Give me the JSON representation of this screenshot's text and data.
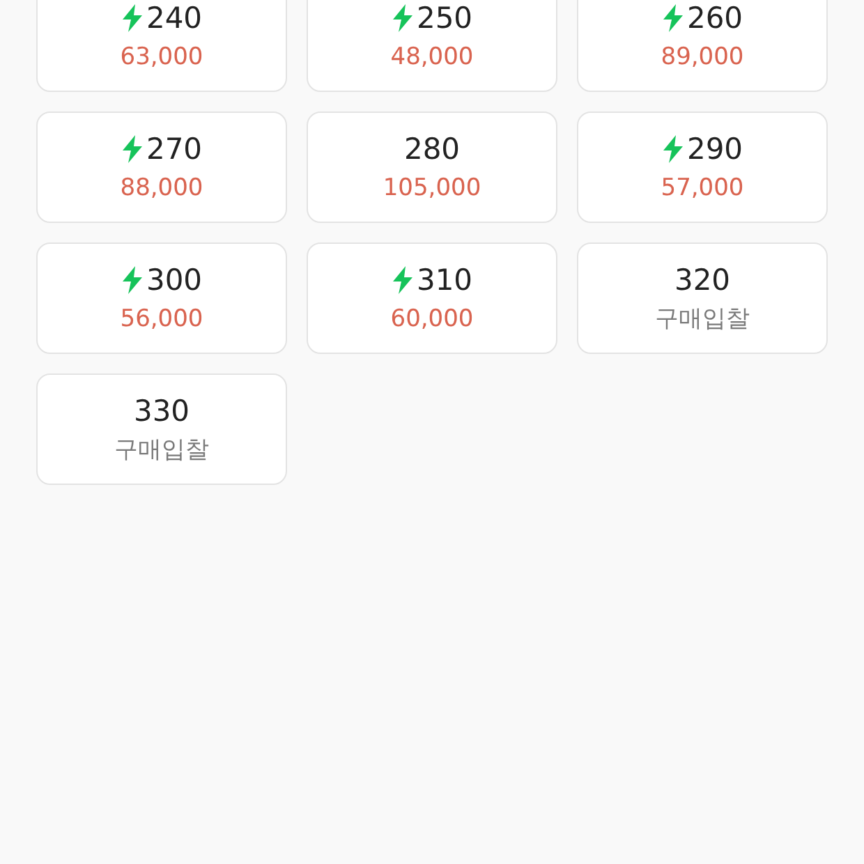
{
  "sizes": [
    {
      "size": "240",
      "fast": true,
      "kind": "price",
      "price": "63,000"
    },
    {
      "size": "250",
      "fast": true,
      "kind": "price",
      "price": "48,000"
    },
    {
      "size": "260",
      "fast": true,
      "kind": "price",
      "price": "89,000"
    },
    {
      "size": "270",
      "fast": true,
      "kind": "price",
      "price": "88,000"
    },
    {
      "size": "280",
      "fast": false,
      "kind": "price",
      "price": "105,000"
    },
    {
      "size": "290",
      "fast": true,
      "kind": "price",
      "price": "57,000"
    },
    {
      "size": "300",
      "fast": true,
      "kind": "price",
      "price": "56,000"
    },
    {
      "size": "310",
      "fast": true,
      "kind": "price",
      "price": "60,000"
    },
    {
      "size": "320",
      "fast": false,
      "kind": "bid",
      "price": "구매입찰"
    },
    {
      "size": "330",
      "fast": false,
      "kind": "bid",
      "price": "구매입찰"
    }
  ]
}
